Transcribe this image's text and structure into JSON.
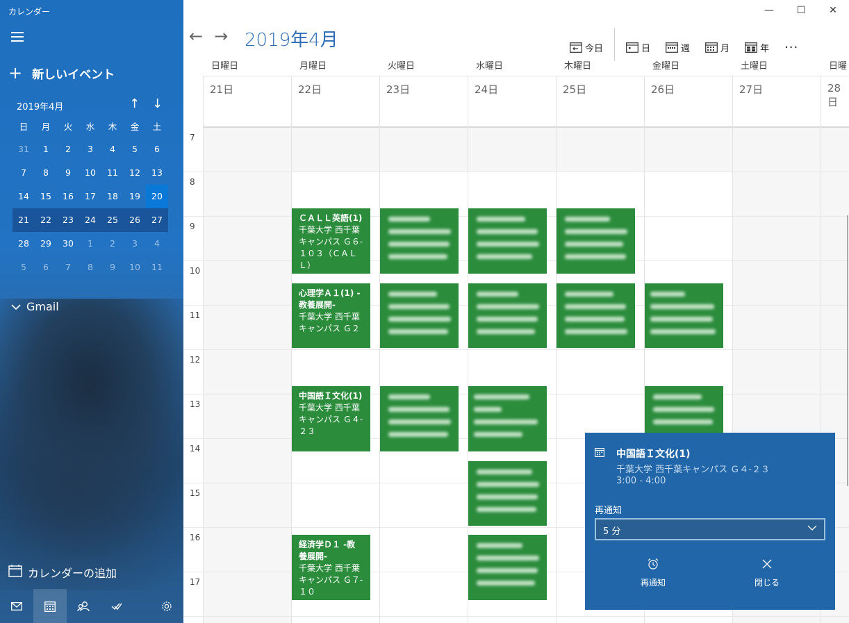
{
  "app": {
    "name": "カレンダー"
  },
  "sidebar": {
    "new_event": "新しいイベント",
    "mini": {
      "title": "2019年4月",
      "weekdays": [
        "日",
        "月",
        "火",
        "水",
        "木",
        "金",
        "土"
      ],
      "weeks": [
        [
          "31",
          "1",
          "2",
          "3",
          "4",
          "5",
          "6"
        ],
        [
          "7",
          "8",
          "9",
          "10",
          "11",
          "12",
          "13"
        ],
        [
          "14",
          "15",
          "16",
          "17",
          "18",
          "19",
          "20"
        ],
        [
          "21",
          "22",
          "23",
          "24",
          "25",
          "26",
          "27"
        ],
        [
          "28",
          "29",
          "30",
          "1",
          "2",
          "3",
          "4"
        ],
        [
          "5",
          "6",
          "7",
          "8",
          "9",
          "10",
          "11"
        ]
      ]
    },
    "account": "Gmail",
    "add_calendar": "カレンダーの追加"
  },
  "header": {
    "month": "2019年4月",
    "today": "今日",
    "day": "日",
    "week": "週",
    "month_view": "月",
    "year": "年",
    "more": "···"
  },
  "days": [
    {
      "name": "日曜日",
      "num": "21日"
    },
    {
      "name": "月曜日",
      "num": "22日"
    },
    {
      "name": "火曜日",
      "num": "23日"
    },
    {
      "name": "水曜日",
      "num": "24日"
    },
    {
      "name": "木曜日",
      "num": "25日"
    },
    {
      "name": "金曜日",
      "num": "26日"
    },
    {
      "name": "土曜日",
      "num": "27日"
    },
    {
      "name": "日曜",
      "num": "28日"
    }
  ],
  "hours": [
    "7",
    "8",
    "9",
    "10",
    "11",
    "12",
    "13",
    "14",
    "15",
    "16",
    "17"
  ],
  "events": {
    "call": {
      "title": "ＣＡＬＬ英語(1)",
      "loc": "千葉大学 西千葉キャンパス Ｇ６-１０３（ＣＡＬＬ）"
    },
    "psych": {
      "title": "心理学Ａ１(1) -教養展開-",
      "loc": "千葉大学 西千葉キャンパス Ｇ２"
    },
    "chinese": {
      "title": "中国語Ｉ文化(1)",
      "loc": "千葉大学 西千葉キャンパス Ｇ４-２３"
    },
    "econ": {
      "title": "経済学Ｄ１ -教養展開-",
      "loc": "千葉大学 西千葉キャンパス Ｇ７-１０"
    }
  },
  "reminder": {
    "title": "中国語Ｉ文化(1)",
    "location": "千葉大学 西千葉キャンパス Ｇ４-２３",
    "time": "3:00 - 4:00",
    "snooze_label": "再通知",
    "snooze_value": "5 分",
    "snooze_button": "再通知",
    "dismiss_button": "閉じる"
  },
  "colors": {
    "event": "#2b8c3c",
    "accent": "#2a6cb6",
    "popup": "#2066a8"
  }
}
